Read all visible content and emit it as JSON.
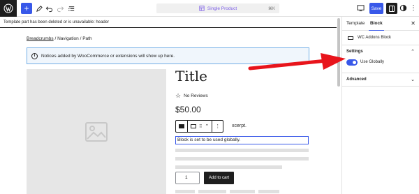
{
  "topbar": {
    "add_label": "+",
    "document_title": "Single Product",
    "document_shortcut": "⌘K",
    "save_label": "Save",
    "more_label": "⋮"
  },
  "notice_bar": {
    "text": "Template part has been deleted or is unavailable: header"
  },
  "breadcrumb": {
    "link": "Breadcrumbs",
    "rest": " / Navigation / Path"
  },
  "wc_notice": {
    "icon": "i",
    "text": "Notices added by WooCommerce or extensions will show up here."
  },
  "product": {
    "title": "Title",
    "reviews": "No Reviews",
    "star": "☆",
    "price": "$50.00",
    "excerpt_tail": "xcerpt.",
    "global_note": "Block is set to be used globally.",
    "quantity": "1",
    "add_to_cart": "Add to cart"
  },
  "block_toolbar": {
    "updown": "⌃",
    "more": "⋮",
    "drag": "⠿"
  },
  "sidebar": {
    "tab_template": "Template",
    "tab_block": "Block",
    "close": "✕",
    "block_name": "WC Addons Block",
    "settings_title": "Settings",
    "settings_chevron": "⌃",
    "toggle_label": "Use Globally",
    "toggle_on": true,
    "advanced_title": "Advanced",
    "advanced_chevron": "⌄"
  },
  "colors": {
    "accent": "#3858e9",
    "annotation_arrow": "#e8141b",
    "notice_border": "#72aee6"
  }
}
